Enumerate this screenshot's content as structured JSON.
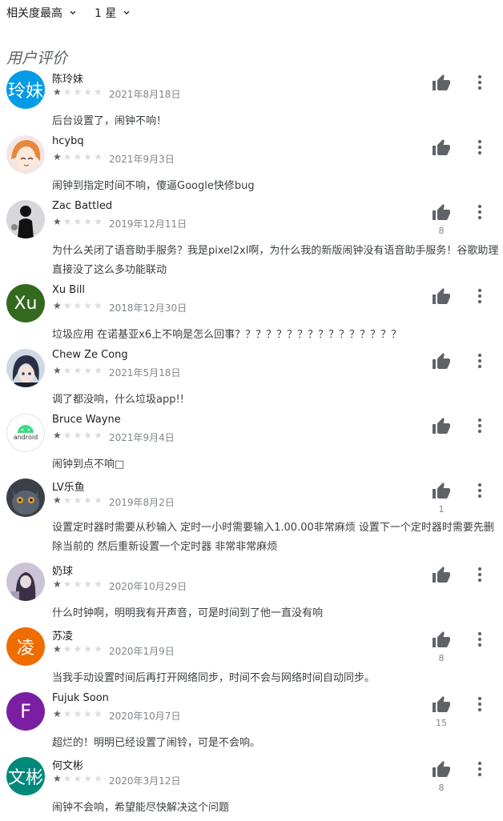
{
  "filters": {
    "sort": "相关度最高",
    "rating": "1 星"
  },
  "section_title": "用户评价",
  "colors": {
    "accent": "#5f6368"
  },
  "reviews": [
    {
      "name": "陈玲妹",
      "date": "2021年8月18日",
      "rating": 1,
      "likes": "",
      "text": "后台设置了，闹钟不响！",
      "avatar": {
        "type": "text",
        "label": "玲妹",
        "color": "#039be5"
      }
    },
    {
      "name": "hcybq",
      "date": "2021年9月3日",
      "rating": 1,
      "likes": "",
      "text": "闹钟到指定时间不响，傻逼Google快修bug",
      "avatar": {
        "type": "anime-girl"
      }
    },
    {
      "name": "Zac Battled",
      "date": "2019年12月11日",
      "rating": 1,
      "likes": "8",
      "text": "为什么关闭了语音助手服务？我是pixel2xl啊，为什么我的新版闹钟没有语音助手服务！谷歌助理直接没了这么多功能联动",
      "avatar": {
        "type": "silhouette"
      }
    },
    {
      "name": "Xu Bill",
      "date": "2018年12月30日",
      "rating": 1,
      "likes": "",
      "text": "垃圾应用 在诺基亚x6上不响是怎么回事？？？？？？？？？？？？？？？？",
      "avatar": {
        "type": "text",
        "label": "Xu",
        "color": "#33691e"
      }
    },
    {
      "name": "Chew Ze Cong",
      "date": "2021年5月18日",
      "rating": 1,
      "likes": "",
      "text": "调了都没响，什么垃圾app!!",
      "avatar": {
        "type": "anime-boy"
      }
    },
    {
      "name": "Bruce Wayne",
      "date": "2021年9月4日",
      "rating": 1,
      "likes": "",
      "text": "闹钟到点不响□",
      "avatar": {
        "type": "android",
        "label": "android"
      }
    },
    {
      "name": "LV乐鱼",
      "date": "2019年8月2日",
      "rating": 1,
      "likes": "1",
      "text": "设置定时器时需要从秒输入 定时一小时需要输入1.00.00非常麻烦 设置下一个定时器时需要先删除当前的 然后重新设置一个定时器 非常非常麻烦",
      "avatar": {
        "type": "cat"
      }
    },
    {
      "name": "奶球",
      "date": "2020年10月29日",
      "rating": 1,
      "likes": "",
      "text": "什么时钟啊，明明我有开声音，可是时间到了他一直没有响",
      "avatar": {
        "type": "girl-photo"
      }
    },
    {
      "name": "苏凌",
      "date": "2020年1月9日",
      "rating": 1,
      "likes": "8",
      "text": "当我手动设置时间后再打开网络同步，时间不会与网络时间自动同步。",
      "avatar": {
        "type": "text",
        "label": "凌",
        "color": "#ef6c00"
      }
    },
    {
      "name": "Fujuk Soon",
      "date": "2020年10月7日",
      "rating": 1,
      "likes": "15",
      "text": "超烂的！明明已经设置了闹铃，可是不会响。",
      "avatar": {
        "type": "text",
        "label": "F",
        "color": "#7b1fa2"
      }
    },
    {
      "name": "何文彬",
      "date": "2020年3月12日",
      "rating": 1,
      "likes": "8",
      "text": "闹钟不会响，希望能尽快解决这个问题",
      "avatar": {
        "type": "text",
        "label": "文彬",
        "color": "#00897b"
      }
    }
  ]
}
